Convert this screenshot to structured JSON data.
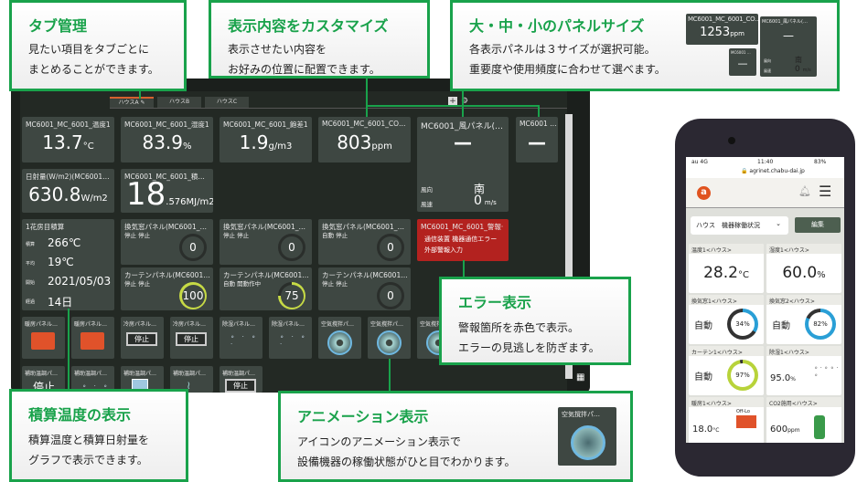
{
  "callouts": {
    "tabs": {
      "title": "タブ管理",
      "lines": [
        "見たい項目をタブごとに",
        "まとめることができます。"
      ]
    },
    "customize": {
      "title": "表示内容をカスタマイズ",
      "lines": [
        "表示させたい内容を",
        "お好みの位置に配置できます。"
      ]
    },
    "sizes": {
      "title": "大・中・小のパネルサイズ",
      "lines": [
        "各表示パネルは３サイズが選択可能。",
        "重要度や使用頻度に合わせて選べます。"
      ],
      "preview": {
        "large_label": "MC6001_MC_6001_CO…",
        "large_value": "1253",
        "large_unit": "ppm",
        "small_label": "MC6001 …",
        "small_value": "—",
        "wind_label": "MC6001_風パネル(…",
        "wind_value": "—",
        "dir_label": "風向",
        "dir_value": "南",
        "speed_label": "風速",
        "speed_value": "0",
        "speed_unit": "m/s"
      }
    },
    "error": {
      "title": "エラー表示",
      "lines": [
        "警報箇所を赤色で表示。",
        "エラーの見逃しを防ぎます。"
      ]
    },
    "accumulate": {
      "title": "積算温度の表示",
      "lines": [
        "積算温度と積算日射量を",
        "グラフで表示できます。"
      ]
    },
    "animation": {
      "title": "アニメーション表示",
      "lines": [
        "アイコンのアニメーション表示で",
        "設備機器の稼働状態がひと目でわかります。"
      ],
      "sample_label": "空気撹拌パ…"
    }
  },
  "dashboard": {
    "tabs": [
      {
        "label": "ハウスA",
        "active": true
      },
      {
        "label": "ハウスB"
      },
      {
        "label": "ハウスC"
      }
    ],
    "add_tab": "+",
    "tiles": [
      {
        "type": "value",
        "label": "MC6001_MC_6001_温度1",
        "value": "13.7",
        "unit": "°C"
      },
      {
        "type": "value",
        "label": "MC6001_MC_6001_湿度1",
        "value": "83.9",
        "unit": "%"
      },
      {
        "type": "value",
        "label": "MC6001_MC_6001_飽差1",
        "value": "1.9",
        "unit": "g/m3"
      },
      {
        "type": "value",
        "label": "MC6001_MC_6001_CO…",
        "value": "803",
        "unit": "ppm"
      },
      {
        "type": "wind",
        "label": "MC6001_風パネル(…",
        "value": "—",
        "dir_label": "風向",
        "dir": "南",
        "speed_label": "風速",
        "speed": "0",
        "speed_unit": "m/s"
      },
      {
        "type": "small",
        "label": "MC6001 …",
        "value": "—"
      },
      {
        "type": "value",
        "label": "日射量(W/m2)(MC6001…",
        "value": "630.8",
        "unit": "W/m2"
      },
      {
        "type": "value",
        "label": "MC6001_MC_6001_積…",
        "value": "18",
        "unit": ".576MJ/m2"
      },
      {
        "type": "accum",
        "label": "1花房目積算",
        "rows": [
          [
            "積算",
            "266℃"
          ],
          [
            "平均",
            "19℃"
          ],
          [
            "開始",
            "2021/05/03"
          ],
          [
            "経過",
            "14日"
          ]
        ]
      },
      {
        "type": "ring",
        "label": "換気窓パネル(MC6001_…",
        "status": "停止 停止",
        "value": "0",
        "percent": 0
      },
      {
        "type": "ring",
        "label": "換気窓パネル(MC6001_…",
        "status": "停止 停止",
        "value": "0",
        "percent": 0
      },
      {
        "type": "ring",
        "label": "換気窓パネル(MC6001_…",
        "status": "自動 停止",
        "value": "0",
        "percent": 0
      },
      {
        "type": "error",
        "label": "MC6001_MC_6001_警報·",
        "lines": [
          "通信装置 機器通信エラー",
          "外部警報入力"
        ]
      },
      {
        "type": "ring",
        "label": "カーテンパネル(MC6001…",
        "status": "停止 停止",
        "value": "100",
        "percent": 100
      },
      {
        "type": "ring",
        "label": "カーテンパネル(MC6001…",
        "status": "自動 開動作中",
        "value": "75",
        "percent": 75
      },
      {
        "type": "ring",
        "label": "カーテンパネル(MC6001…",
        "status": "停止 停止",
        "value": "0",
        "percent": 0
      }
    ],
    "icon_tiles": [
      {
        "label": "暖房パネル…",
        "icon": "heater-icon"
      },
      {
        "label": "暖房パネル…",
        "icon": "heater-icon"
      },
      {
        "label": "冷房パネル…",
        "icon": "stop-button",
        "text": "停止"
      },
      {
        "label": "冷房パネル…",
        "icon": "stop-button",
        "text": "停止"
      },
      {
        "label": "除湿パネル…",
        "icon": "mist-icon"
      },
      {
        "label": "除湿パネル…",
        "icon": "mist-icon"
      },
      {
        "label": "空気撹拌パ…",
        "icon": "fan-icon"
      },
      {
        "label": "空気撹拌パ…",
        "icon": "fan-icon"
      },
      {
        "label": "空気撹拌パ…",
        "icon": "fan-icon"
      },
      {
        "label": "補助温調パ…",
        "icon": "stop-text",
        "text": "停止"
      },
      {
        "label": "補助温調パ…",
        "icon": "mist-icon"
      },
      {
        "label": "補助温調パ…",
        "icon": "fan-box-icon"
      },
      {
        "label": "補助温調パ…",
        "icon": "steam-icon"
      },
      {
        "label": "補助温調パ…",
        "icon": "stop-button",
        "text": "停止"
      }
    ]
  },
  "phone": {
    "carrier": "au 4G",
    "time": "11:40",
    "battery": "83%",
    "url": "agrinet.chabu-dai.jp",
    "select": "ハウス　機器稼働状況",
    "edit": "編集",
    "tiles": [
      {
        "label": "温度1<ハウス>",
        "value": "28.2",
        "unit": "°C"
      },
      {
        "label": "湿度1<ハウス>",
        "value": "60.0",
        "unit": "%"
      },
      {
        "label": "換気窓1<ハウス>",
        "mode": "自動",
        "percent": 34,
        "pct_text": "34%",
        "color": "#2a9fd6"
      },
      {
        "label": "換気窓2<ハウス>",
        "mode": "自動",
        "percent": 82,
        "pct_text": "82%",
        "color": "#2a9fd6"
      },
      {
        "label": "カーテン1<ハウス>",
        "mode": "自動",
        "percent": 97,
        "pct_text": "97%",
        "color": "#b8d33a"
      },
      {
        "label": "除湿1<ハウス>",
        "value": "95.0",
        "unit": "%",
        "icon": "mist-icon"
      },
      {
        "label": "暖房1<ハウス>",
        "value": "18.0",
        "unit": "°C",
        "icon": "heater-icon",
        "note": "Off-Lo"
      },
      {
        "label": "CO2施用<ハウス>",
        "value": "600",
        "unit": "ppm",
        "icon": "co2-tank-icon"
      }
    ]
  }
}
